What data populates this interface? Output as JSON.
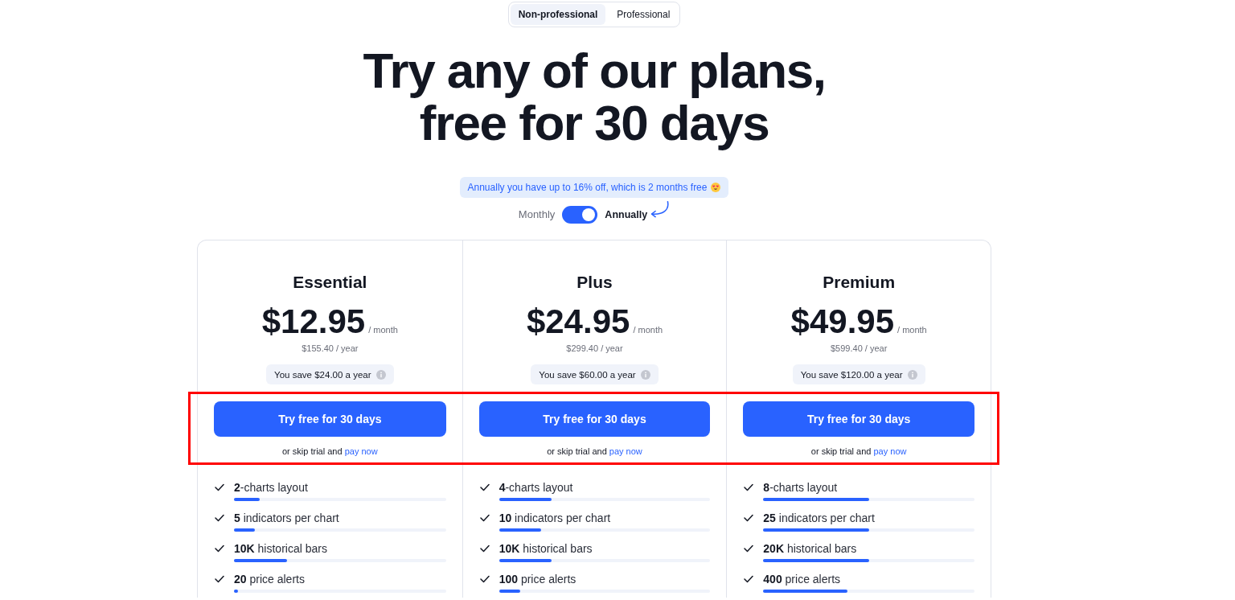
{
  "audience_tabs": [
    {
      "label": "Non-professional",
      "selected": true
    },
    {
      "label": "Professional",
      "selected": false
    }
  ],
  "headline": "Try any of our plans, free for 30 days",
  "discount_banner": {
    "text": "Annually you have up to 16% off, which is 2 months free"
  },
  "billing_toggle": {
    "left_label": "Monthly",
    "right_label": "Annually",
    "on": true
  },
  "plans": {
    "cta_highlighted": true,
    "items": [
      {
        "name": "Essential",
        "price": "$12.95",
        "price_unit": "/ month",
        "yearly_price": "$155.40 / year",
        "savings": "You save $24.00 a year",
        "cta": "Try free for 30 days",
        "skip_text": "or skip trial and",
        "skip_link": "pay now",
        "features": [
          {
            "text": "**2**-charts layout",
            "level": 0.12
          },
          {
            "text": "**5** indicators per chart",
            "level": 0.1
          },
          {
            "text": "**10K** historical bars",
            "level": 0.25
          },
          {
            "text": "**20** price alerts",
            "level": 0.02
          }
        ]
      },
      {
        "name": "Plus",
        "price": "$24.95",
        "price_unit": "/ month",
        "yearly_price": "$299.40 / year",
        "savings": "You save $60.00 a year",
        "cta": "Try free for 30 days",
        "skip_text": "or skip trial and",
        "skip_link": "pay now",
        "features": [
          {
            "text": "**4**-charts layout",
            "level": 0.25
          },
          {
            "text": "**10** indicators per chart",
            "level": 0.2
          },
          {
            "text": "**10K** historical bars",
            "level": 0.25
          },
          {
            "text": "**100** price alerts",
            "level": 0.1
          }
        ]
      },
      {
        "name": "Premium",
        "price": "$49.95",
        "price_unit": "/ month",
        "yearly_price": "$599.40 / year",
        "savings": "You save $120.00 a year",
        "cta": "Try free for 30 days",
        "skip_text": "or skip trial and",
        "skip_link": "pay now",
        "features": [
          {
            "text": "**8**-charts layout",
            "level": 0.5
          },
          {
            "text": "**25** indicators per chart",
            "level": 0.5
          },
          {
            "text": "**20K** historical bars",
            "level": 0.5
          },
          {
            "text": "**400** price alerts",
            "level": 0.4
          }
        ]
      }
    ]
  }
}
